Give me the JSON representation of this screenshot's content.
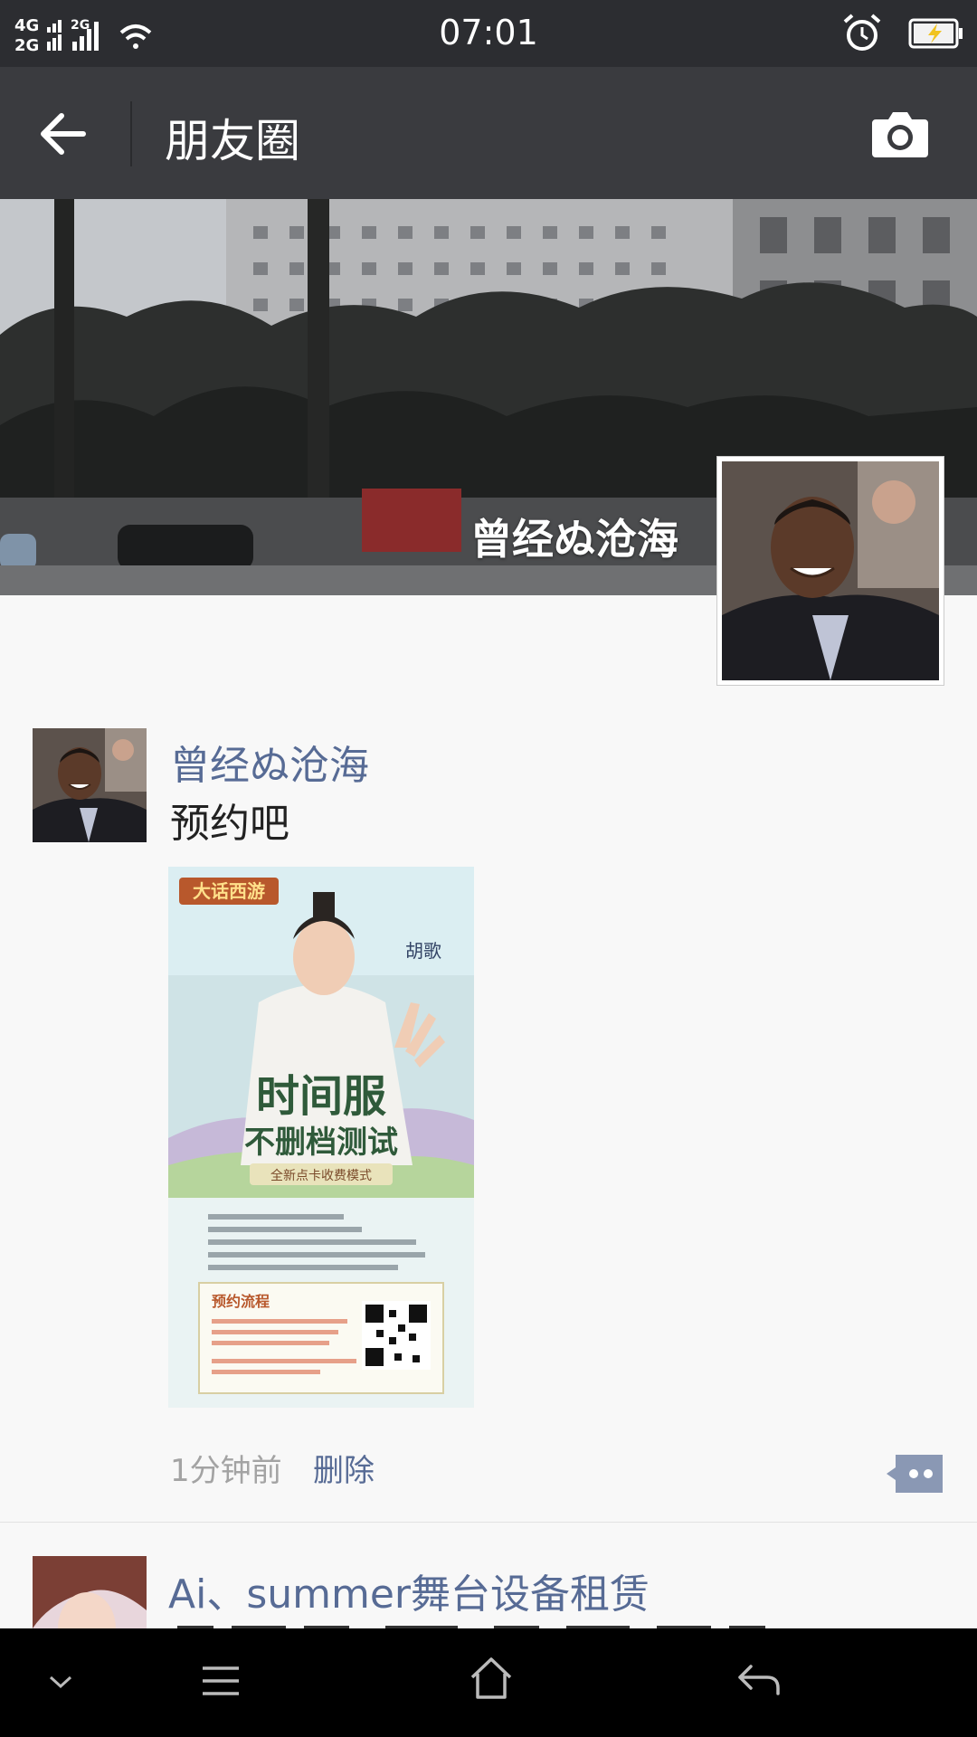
{
  "status_bar": {
    "network_top": "4G",
    "network_bottom": "2G",
    "network_2": "2G",
    "time": "07:01",
    "icons": [
      "signal-icon",
      "wifi-icon",
      "alarm-icon",
      "battery-charging-icon"
    ]
  },
  "title_bar": {
    "title": "朋友圈",
    "icons": [
      "back-arrow-icon",
      "camera-icon"
    ]
  },
  "cover": {
    "user_name": "曾经ぬ沧海"
  },
  "post": {
    "author": "曾经ぬ沧海",
    "text": "预约吧",
    "time": "1分钟前",
    "delete_label": "删除",
    "image": {
      "game_title": "大话西游",
      "headline_1": "时间服",
      "headline_2": "不删档测试",
      "subhead": "全新点卡收费模式",
      "spokesperson": "胡歌",
      "section_title": "预约流程"
    }
  },
  "next_post": {
    "author": "Ai、summer舞台设备租赁"
  },
  "nav_bar": {
    "icons": [
      "chevron-down-icon",
      "menu-icon",
      "home-icon",
      "back-icon"
    ]
  },
  "colors": {
    "status_bar": "#2c2d31",
    "title_bar": "#3a3b3f",
    "link": "#576b95",
    "background": "#f8f8f8"
  }
}
